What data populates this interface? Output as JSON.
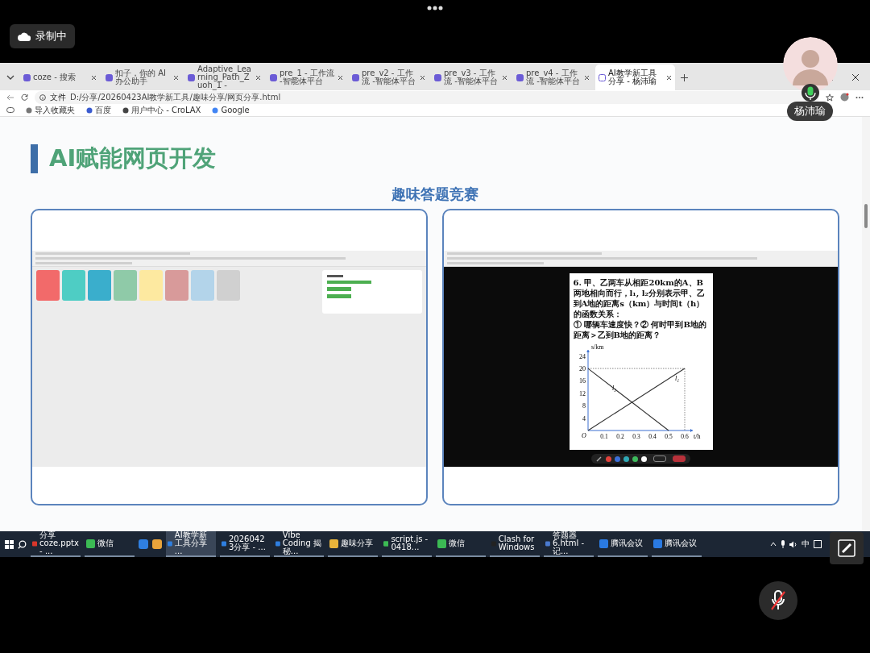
{
  "meeting": {
    "recording_label": "录制中",
    "participant": {
      "name": "杨沛瑜",
      "speaking": true
    },
    "mic_muted": true
  },
  "browser": {
    "tabs": [
      {
        "label": "coze - 搜索",
        "selected": false
      },
      {
        "label": "扣子，你的 AI 办公助手",
        "selected": false
      },
      {
        "label": "Adaptive_Learning_Path_Zuoh_1 -",
        "selected": false
      },
      {
        "label": "pre_1 - 工作流 -智能体平台",
        "selected": false
      },
      {
        "label": "pre_v2 - 工作流 -智能体平台",
        "selected": false
      },
      {
        "label": "pre_v3 - 工作流 -智能体平台",
        "selected": false
      },
      {
        "label": "pre_v4 - 工作流 -智能体平台",
        "selected": false
      },
      {
        "label": "AI教学新工具分享 - 杨沛瑜",
        "selected": true
      }
    ],
    "address": {
      "prefix": "文件",
      "url": "D:/分享/20260423AI教学新工具/趣味分享/网页分享.html"
    },
    "bookmarks": [
      "导入收藏夹",
      "百度",
      "用户中心 - CroLAX",
      "Google"
    ]
  },
  "slide": {
    "title": "AI赋能网页开发",
    "subtitle": "趣味答题竞赛",
    "left_panel": {
      "cards": [
        {
          "color": "#f26a6a"
        },
        {
          "color": "#4ecdc4"
        },
        {
          "color": "#3aaecc"
        },
        {
          "color": "#8fcaa8"
        },
        {
          "color": "#fde9a0"
        },
        {
          "color": "#d89a9a"
        },
        {
          "color": "#b3d4ea"
        },
        {
          "color": "#d0d0d0"
        }
      ]
    },
    "right_panel": {
      "question": [
        "6. 甲、乙两车从相距20km的A、B两地相向而行，l₁, l₂分别表示甲、乙到A地的距离s（km）与时间t（h）的函数关系：",
        "① 哪辆车速度快？② 何时甲到B地的距离＞乙到B地的距离？"
      ],
      "chart_data": {
        "type": "line",
        "xlabel": "t/h",
        "ylabel": "s/km",
        "x": [
          0,
          0.3,
          0.5,
          0.6
        ],
        "series": [
          {
            "name": "l₁",
            "values": [
              0,
              10,
              null,
              20
            ]
          },
          {
            "name": "l₂",
            "values": [
              20,
              8,
              0,
              null
            ]
          }
        ],
        "ref_lines": [
          {
            "axis": "y",
            "value": 20
          },
          {
            "axis": "x",
            "value": 0.6
          }
        ],
        "xlim": [
          0,
          0.65
        ],
        "ylim": [
          0,
          26
        ],
        "xticks": [
          0.1,
          0.2,
          0.3,
          0.4,
          0.5,
          0.6
        ],
        "yticks": [
          4,
          8,
          12,
          16,
          20,
          24
        ],
        "annotations": [
          "O"
        ]
      },
      "pen_colors": [
        {
          "color": "#e0413b"
        },
        {
          "color": "#3b6fd9"
        },
        {
          "color": "#2fa9b5"
        },
        {
          "color": "#3dba5c"
        },
        {
          "color": "#ffffff"
        }
      ]
    }
  },
  "taskbar": {
    "items": [
      {
        "kind": "app",
        "label": "分享coze.pptx - ...",
        "selected": false
      },
      {
        "kind": "app",
        "label": "微信",
        "selected": false
      },
      {
        "kind": "pinned"
      },
      {
        "kind": "pinned"
      },
      {
        "kind": "app",
        "label": "AI教学新工具分享 ...",
        "selected": true
      },
      {
        "kind": "app",
        "label": "20260423分享 - ...",
        "selected": false
      },
      {
        "kind": "app",
        "label": "Vibe Coding 揭秘...",
        "selected": false
      },
      {
        "kind": "app",
        "label": "趣味分享",
        "selected": false
      },
      {
        "kind": "app",
        "label": "script.js - 0418...",
        "selected": false
      },
      {
        "kind": "app",
        "label": "微信",
        "selected": false
      },
      {
        "kind": "app",
        "label": "Clash for Windows",
        "selected": false
      },
      {
        "kind": "app",
        "label": "答题器6.html - 记...",
        "selected": false
      },
      {
        "kind": "app",
        "label": "腾讯会议",
        "selected": false
      },
      {
        "kind": "app",
        "label": "腾讯会议",
        "selected": false
      }
    ],
    "ime": "中"
  }
}
